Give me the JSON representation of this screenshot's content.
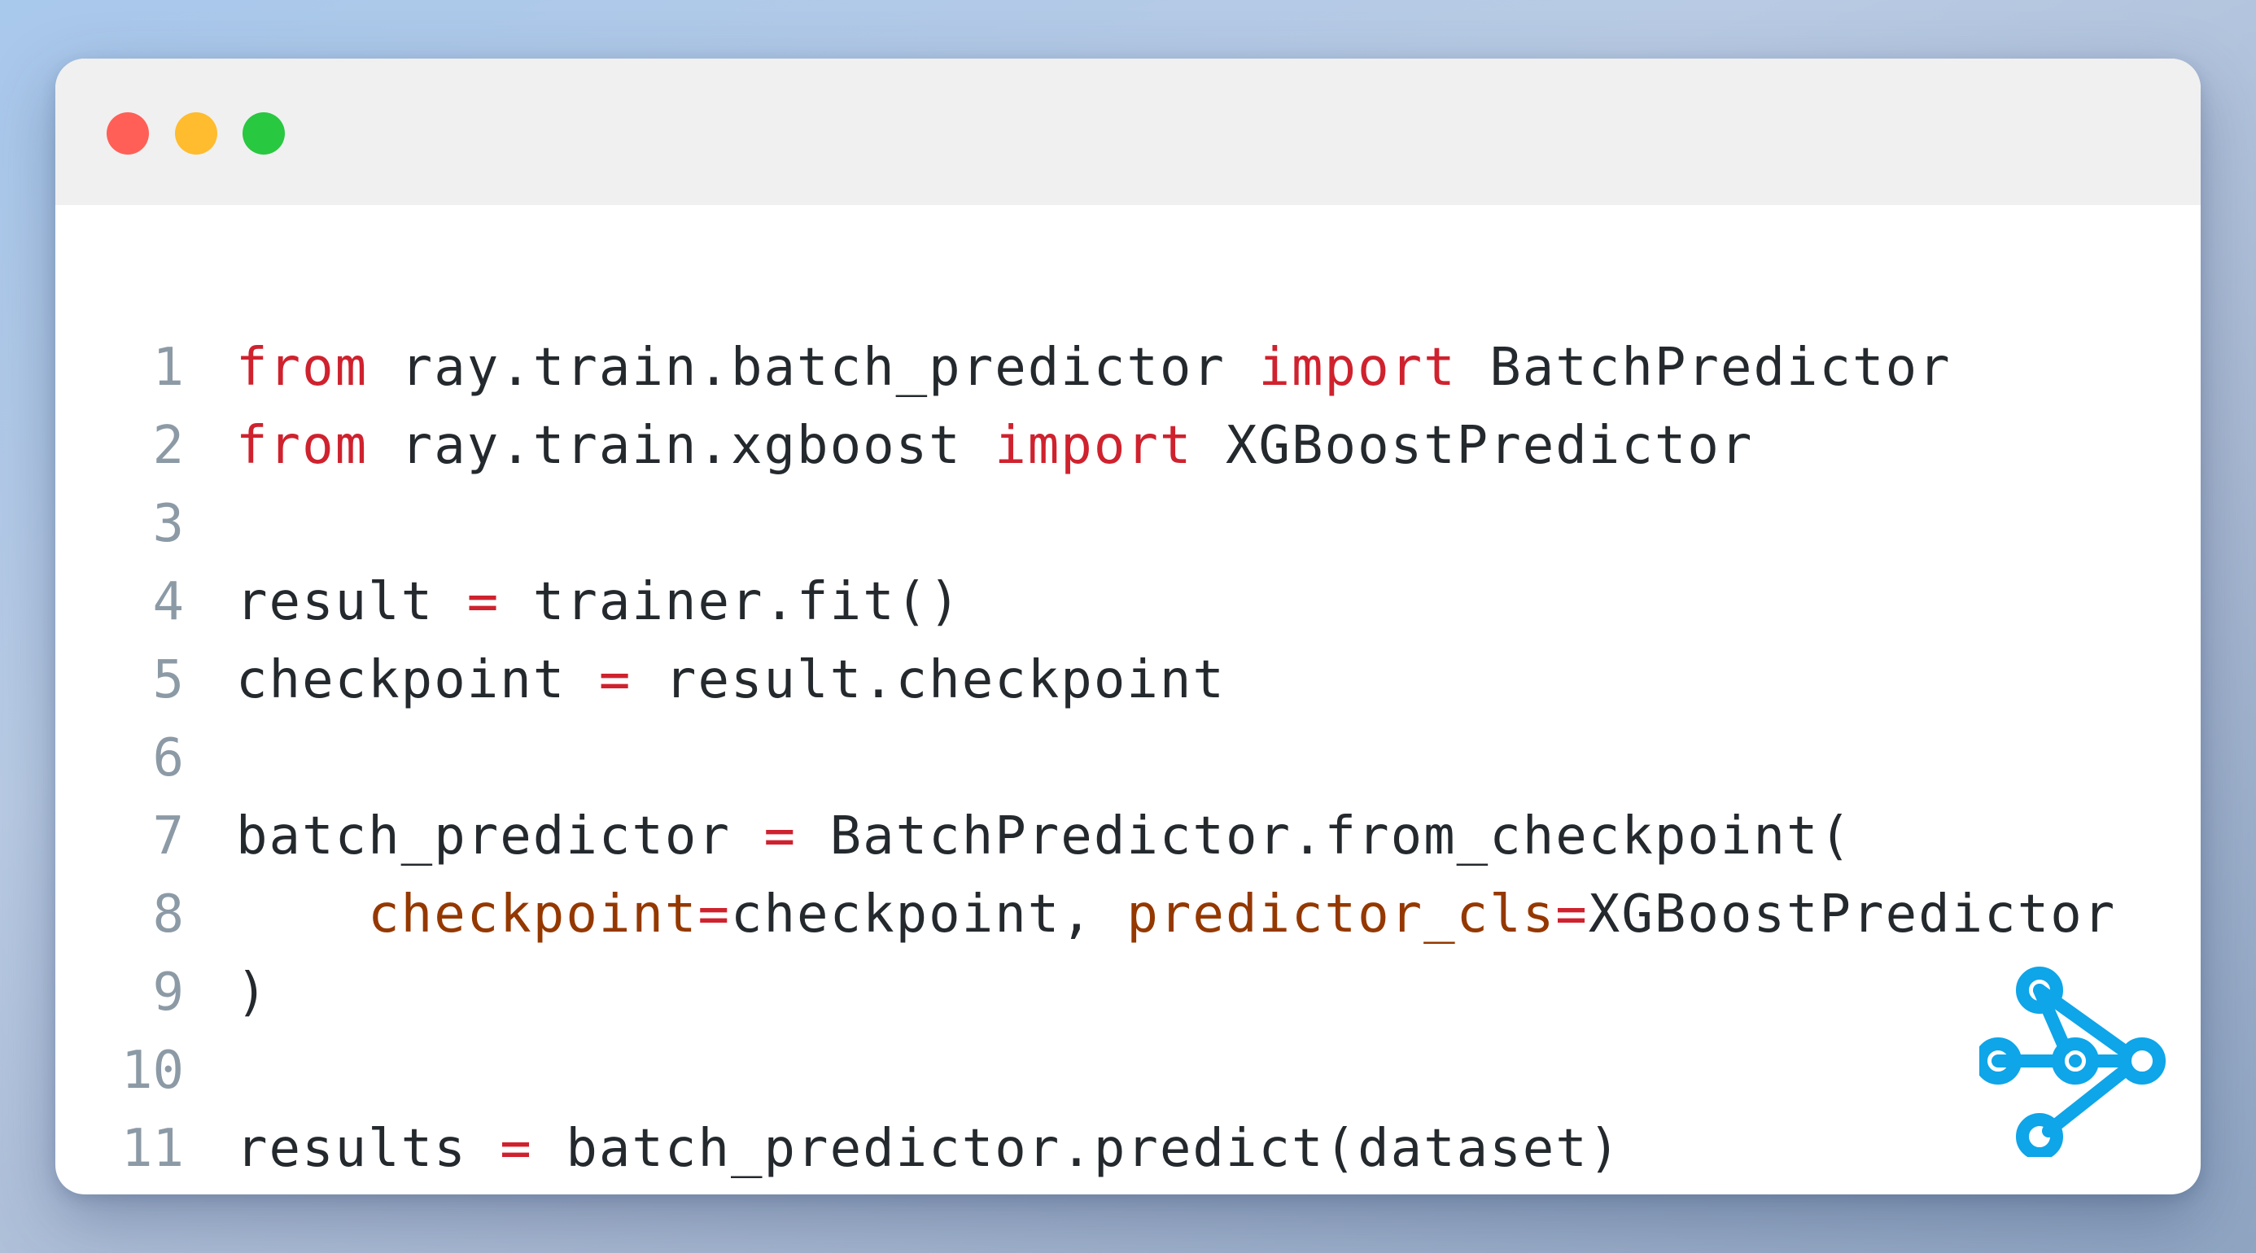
{
  "window": {
    "controls": [
      "close",
      "minimize",
      "maximize"
    ]
  },
  "code": {
    "lines": [
      {
        "number": "1",
        "tokens": [
          {
            "text": "from",
            "kind": "kw"
          },
          {
            "text": " ray.train.batch_predictor ",
            "kind": "plain"
          },
          {
            "text": "import",
            "kind": "kw"
          },
          {
            "text": " BatchPredictor",
            "kind": "plain"
          }
        ]
      },
      {
        "number": "2",
        "tokens": [
          {
            "text": "from",
            "kind": "kw"
          },
          {
            "text": " ray.train.xgboost ",
            "kind": "plain"
          },
          {
            "text": "import",
            "kind": "kw"
          },
          {
            "text": " XGBoostPredictor",
            "kind": "plain"
          }
        ]
      },
      {
        "number": "3",
        "tokens": []
      },
      {
        "number": "4",
        "tokens": [
          {
            "text": "result ",
            "kind": "plain"
          },
          {
            "text": "=",
            "kind": "op"
          },
          {
            "text": " trainer.fit()",
            "kind": "plain"
          }
        ]
      },
      {
        "number": "5",
        "tokens": [
          {
            "text": "checkpoint ",
            "kind": "plain"
          },
          {
            "text": "=",
            "kind": "op"
          },
          {
            "text": " result.checkpoint",
            "kind": "plain"
          }
        ]
      },
      {
        "number": "6",
        "tokens": []
      },
      {
        "number": "7",
        "tokens": [
          {
            "text": "batch_predictor ",
            "kind": "plain"
          },
          {
            "text": "=",
            "kind": "op"
          },
          {
            "text": " BatchPredictor.from_checkpoint(",
            "kind": "plain"
          }
        ]
      },
      {
        "number": "8",
        "tokens": [
          {
            "text": "    ",
            "kind": "plain"
          },
          {
            "text": "checkpoint",
            "kind": "arg"
          },
          {
            "text": "=",
            "kind": "op"
          },
          {
            "text": "checkpoint, ",
            "kind": "plain"
          },
          {
            "text": "predictor_cls",
            "kind": "arg"
          },
          {
            "text": "=",
            "kind": "op"
          },
          {
            "text": "XGBoostPredictor",
            "kind": "plain"
          }
        ]
      },
      {
        "number": "9",
        "tokens": [
          {
            "text": ")",
            "kind": "plain"
          }
        ]
      },
      {
        "number": "10",
        "tokens": []
      },
      {
        "number": "11",
        "tokens": [
          {
            "text": "results ",
            "kind": "plain"
          },
          {
            "text": "=",
            "kind": "op"
          },
          {
            "text": " batch_predictor.predict(dataset)",
            "kind": "plain"
          }
        ]
      }
    ]
  },
  "colors": {
    "keyword": "#cf222e",
    "argument": "#953800",
    "text": "#24292e",
    "line_number": "#8c9aa6",
    "logo": "#0ea5e9",
    "titlebar": "#f0f0f0",
    "close": "#ff5f57",
    "minimize": "#febc2e",
    "maximize": "#28c840"
  },
  "logo": {
    "icon": "ray-logo-icon"
  }
}
